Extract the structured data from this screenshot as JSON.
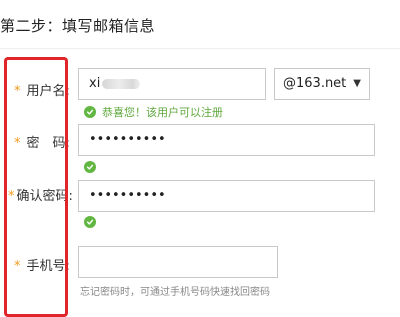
{
  "page": {
    "step_title": "第二步：填写邮箱信息"
  },
  "form": {
    "required_mark": "*",
    "username": {
      "label": "用户名:",
      "value": "xi",
      "domain_select": "@163.net",
      "success_text": "恭喜您！该用户可以注册"
    },
    "password": {
      "label": "密　码:",
      "value": "••••••••••"
    },
    "confirm_password": {
      "label": "确认密码:",
      "value": "••••••••••"
    },
    "phone": {
      "label": "手机号:",
      "value": "",
      "hint": "忘记密码时，可通过手机号码快速找回密码"
    }
  },
  "colors": {
    "highlight_border": "#e0262a",
    "required_star": "#f29a1b",
    "success_green": "#62b742"
  },
  "icons": {
    "success": "check-circle-icon",
    "dropdown": "caret-down-icon"
  }
}
